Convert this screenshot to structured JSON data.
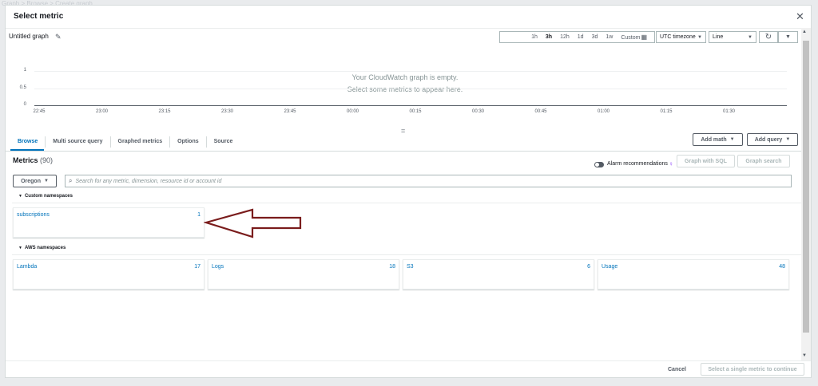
{
  "background": {
    "breadcrumb": "Graph  >  Browse  >  Create graph"
  },
  "modal": {
    "title": "Select metric",
    "close_icon": "close-icon"
  },
  "graph": {
    "title": "Untitled graph",
    "time_ranges": [
      "1h",
      "3h",
      "12h",
      "1d",
      "3d",
      "1w"
    ],
    "selected_range": "3h",
    "custom_label": "Custom",
    "timezone": "UTC timezone",
    "chart_type": "Line",
    "empty_line1": "Your CloudWatch graph is empty.",
    "empty_line2": "Select some metrics to appear here.",
    "divider_glyph": "="
  },
  "chart_data": {
    "type": "line",
    "title": "",
    "xlabel": "",
    "ylabel": "",
    "y_ticks": [
      "1",
      "0.5",
      "0"
    ],
    "ylim": [
      0,
      1
    ],
    "x_ticks": [
      "22:45",
      "23:00",
      "23:15",
      "23:30",
      "23:45",
      "00:00",
      "00:15",
      "00:30",
      "00:45",
      "01:00",
      "01:15",
      "01:30"
    ],
    "series": [],
    "grid": true
  },
  "tabs": [
    "Browse",
    "Multi source query",
    "Graphed metrics",
    "Options",
    "Source"
  ],
  "active_tab": "Browse",
  "buttons": {
    "add_math": "Add math",
    "add_query": "Add query",
    "graph_with_sql": "Graph with SQL",
    "graph_search": "Graph search",
    "cancel": "Cancel",
    "continue": "Select a single metric to continue"
  },
  "metrics": {
    "label": "Metrics",
    "count": "(90)",
    "alarm_recommendations": "Alarm recommendations",
    "region": "Oregon",
    "search_placeholder": "Search for any metric, dimension, resource id or account id"
  },
  "custom_namespaces": {
    "header": "Custom namespaces",
    "items": [
      {
        "name": "subscriptions",
        "count": "1"
      }
    ]
  },
  "aws_namespaces": {
    "header": "AWS namespaces",
    "items": [
      {
        "name": "Lambda",
        "count": "17"
      },
      {
        "name": "Logs",
        "count": "18"
      },
      {
        "name": "S3",
        "count": "6"
      },
      {
        "name": "Usage",
        "count": "48"
      }
    ]
  },
  "annotation": {
    "arrow_color": "#7a1c1c"
  },
  "colors": {
    "link": "#0073bb",
    "text": "#16191f",
    "muted": "#545b64"
  }
}
